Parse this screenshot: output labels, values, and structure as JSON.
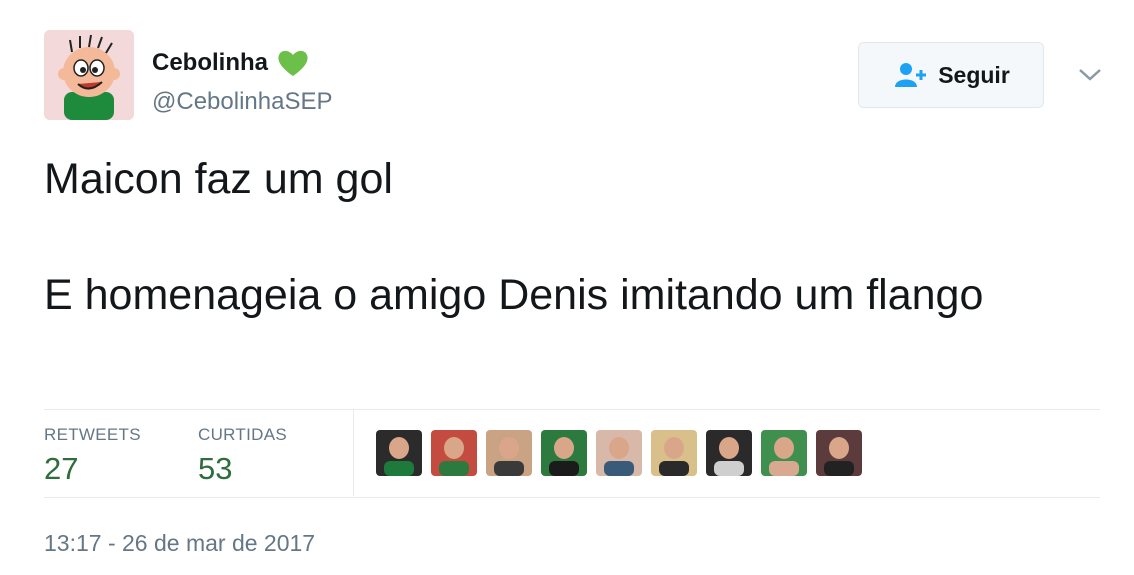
{
  "author": {
    "display_name": "Cebolinha",
    "handle": "@CebolinhaSEP",
    "badge_icon": "green-heart-icon",
    "badge_color": "#6cc04a"
  },
  "follow_button": {
    "label": "Seguir",
    "icon": "add-user-icon",
    "icon_color": "#1da1f2"
  },
  "menu": {
    "icon": "chevron-down-icon"
  },
  "tweet": {
    "line1": "Maicon faz um gol",
    "line2": "E homenageia o amigo Denis imitando um flango"
  },
  "stats": {
    "retweets_label": "RETWEETS",
    "retweets_value": "27",
    "likes_label": "CURTIDAS",
    "likes_value": "53"
  },
  "likers": [
    {
      "name": "liker-1",
      "colors": [
        "#2b2b2b",
        "#1e7a3a"
      ]
    },
    {
      "name": "liker-2",
      "colors": [
        "#c44b3f",
        "#2d7a3e"
      ]
    },
    {
      "name": "liker-3",
      "colors": [
        "#c9a384",
        "#3a3a3a"
      ]
    },
    {
      "name": "liker-4",
      "colors": [
        "#2d7a3e",
        "#1b1b1b"
      ]
    },
    {
      "name": "liker-5",
      "colors": [
        "#d8b8a8",
        "#3a5a7a"
      ]
    },
    {
      "name": "liker-6",
      "colors": [
        "#d9c08a",
        "#2a2a2a"
      ]
    },
    {
      "name": "liker-7",
      "colors": [
        "#2a2a2a",
        "#cfcfcf"
      ]
    },
    {
      "name": "liker-8",
      "colors": [
        "#3f8f4f",
        "#d8a890"
      ]
    },
    {
      "name": "liker-9",
      "colors": [
        "#5b3b3b",
        "#222222"
      ]
    }
  ],
  "timestamp": "13:17 - 26 de mar de 2017"
}
